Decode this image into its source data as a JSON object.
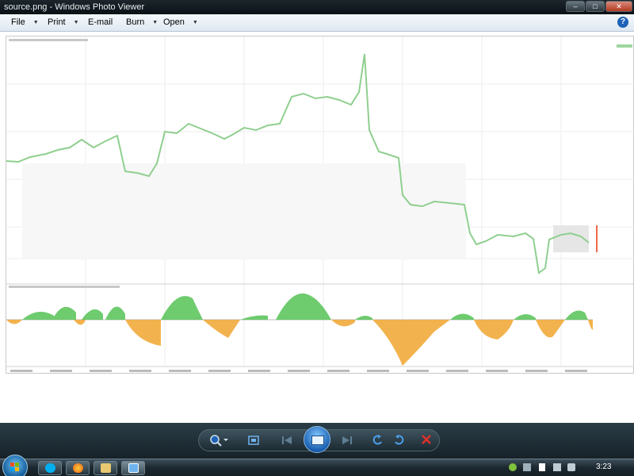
{
  "window": {
    "title": "source.png - Windows Photo Viewer",
    "min_label": "–",
    "max_label": "□",
    "close_label": "✕"
  },
  "menu": {
    "file": "File",
    "print": "Print",
    "email": "E-mail",
    "burn": "Burn",
    "open": "Open",
    "help": "?"
  },
  "taskbar": {
    "clock": "3:23"
  },
  "colors": {
    "price_line": "#8fcf8f",
    "osc_positive": "#55c255",
    "osc_negative": "#f0a630",
    "accent": "#1f63b8"
  },
  "icons": {
    "zoom": "magnifier-icon",
    "fit": "fit-to-window-icon",
    "previous": "previous-icon",
    "slideshow": "slideshow-icon",
    "next": "next-icon",
    "rotate_ccw": "rotate-counterclockwise-icon",
    "rotate_cw": "rotate-clockwise-icon",
    "delete": "delete-icon"
  }
}
